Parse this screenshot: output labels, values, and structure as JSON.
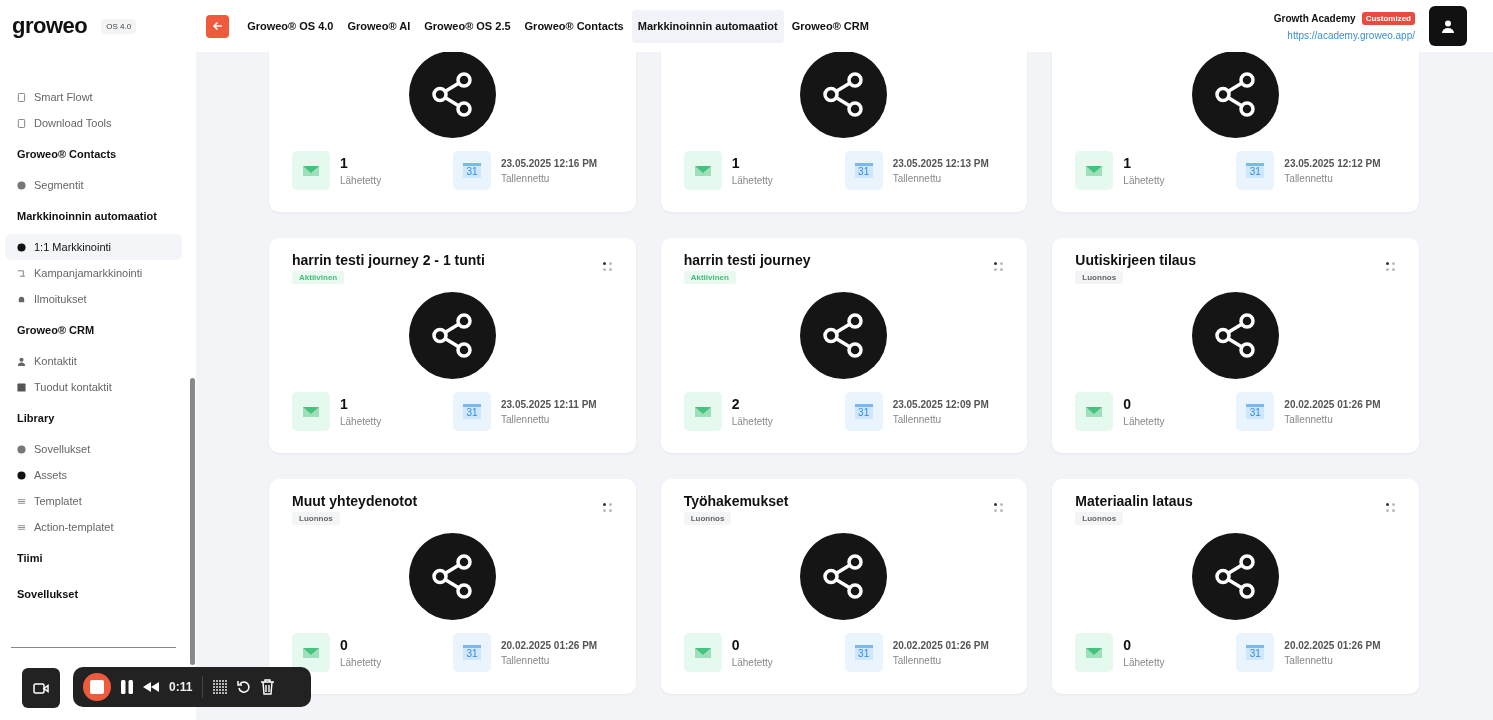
{
  "header": {
    "logo": "groweo",
    "version": "OS 4.0",
    "tabs": [
      {
        "label": "Groweo® OS 4.0",
        "selected": false
      },
      {
        "label": "Groweo® AI",
        "selected": false
      },
      {
        "label": "Groweo® OS 2.5",
        "selected": false
      },
      {
        "label": "Groweo® Contacts",
        "selected": false
      },
      {
        "label": "Markkinoinnin automaatiot",
        "selected": true
      },
      {
        "label": "Groweo® CRM",
        "selected": false
      }
    ],
    "workspace": {
      "name": "Growth Academy",
      "badge": "Customized",
      "url": "https://academy.groweo.app/"
    }
  },
  "sidebar": {
    "entries": [
      {
        "kind": "item",
        "label": "Smart Flowt",
        "selected": false
      },
      {
        "kind": "item",
        "label": "Download Tools",
        "selected": false
      },
      {
        "kind": "header",
        "label": "Groweo® Contacts"
      },
      {
        "kind": "item",
        "label": "Segmentit",
        "selected": false
      },
      {
        "kind": "header",
        "label": "Markkinoinnin automaatiot"
      },
      {
        "kind": "item",
        "label": "1:1 Markkinointi",
        "selected": true
      },
      {
        "kind": "item",
        "label": "Kampanjamarkkinointi",
        "selected": false
      },
      {
        "kind": "item",
        "label": "Ilmoitukset",
        "selected": false
      },
      {
        "kind": "header",
        "label": "Groweo® CRM"
      },
      {
        "kind": "item",
        "label": "Kontaktit",
        "selected": false
      },
      {
        "kind": "item",
        "label": "Tuodut kontaktit",
        "selected": false
      },
      {
        "kind": "header",
        "label": "Library"
      },
      {
        "kind": "item",
        "label": "Sovellukset",
        "selected": false
      },
      {
        "kind": "item",
        "label": "Assets",
        "selected": false
      },
      {
        "kind": "item",
        "label": "Templatet",
        "selected": false
      },
      {
        "kind": "item",
        "label": "Action-templatet",
        "selected": false
      },
      {
        "kind": "header",
        "label": "Tiimi"
      },
      {
        "kind": "header",
        "label": "Sovellukset"
      }
    ]
  },
  "cards": [
    {
      "sent": "1",
      "sent_label": "Lähetetty",
      "date": "23.05.2025 12:16 PM",
      "date_label": "Tallennettu",
      "calendar_day": "31"
    },
    {
      "sent": "1",
      "sent_label": "Lähetetty",
      "date": "23.05.2025 12:13 PM",
      "date_label": "Tallennettu",
      "calendar_day": "31"
    },
    {
      "sent": "1",
      "sent_label": "Lähetetty",
      "date": "23.05.2025 12:12 PM",
      "date_label": "Tallennettu",
      "calendar_day": "31"
    },
    {
      "title": "harrin testi journey 2 - 1 tunti",
      "status": {
        "label": "Aktiivinen",
        "kind": "active"
      },
      "sent": "1",
      "sent_label": "Lähetetty",
      "date": "23.05.2025 12:11 PM",
      "date_label": "Tallennettu",
      "calendar_day": "31"
    },
    {
      "title": "harrin testi journey",
      "status": {
        "label": "Aktiivinen",
        "kind": "active"
      },
      "sent": "2",
      "sent_label": "Lähetetty",
      "date": "23.05.2025 12:09 PM",
      "date_label": "Tallennettu",
      "calendar_day": "31"
    },
    {
      "title": "Uutiskirjeen tilaus",
      "status": {
        "label": "Luonnos",
        "kind": "draft"
      },
      "sent": "0",
      "sent_label": "Lähetetty",
      "date": "20.02.2025 01:26 PM",
      "date_label": "Tallennettu",
      "calendar_day": "31"
    },
    {
      "title": "Muut yhteydenotot",
      "status": {
        "label": "Luonnos",
        "kind": "draft"
      },
      "sent": "0",
      "sent_label": "Lähetetty",
      "date": "20.02.2025 01:26 PM",
      "date_label": "Tallennettu",
      "calendar_day": "31"
    },
    {
      "title": "Työhakemukset",
      "status": {
        "label": "Luonnos",
        "kind": "draft"
      },
      "sent": "0",
      "sent_label": "Lähetetty",
      "date": "20.02.2025 01:26 PM",
      "date_label": "Tallennettu",
      "calendar_day": "31"
    },
    {
      "title": "Materiaalin lataus",
      "status": {
        "label": "Luonnos",
        "kind": "draft"
      },
      "sent": "0",
      "sent_label": "Lähetetty",
      "date": "20.02.2025 01:26 PM",
      "date_label": "Tallennettu",
      "calendar_day": "31"
    }
  ],
  "recorder": {
    "time": "0:11"
  }
}
